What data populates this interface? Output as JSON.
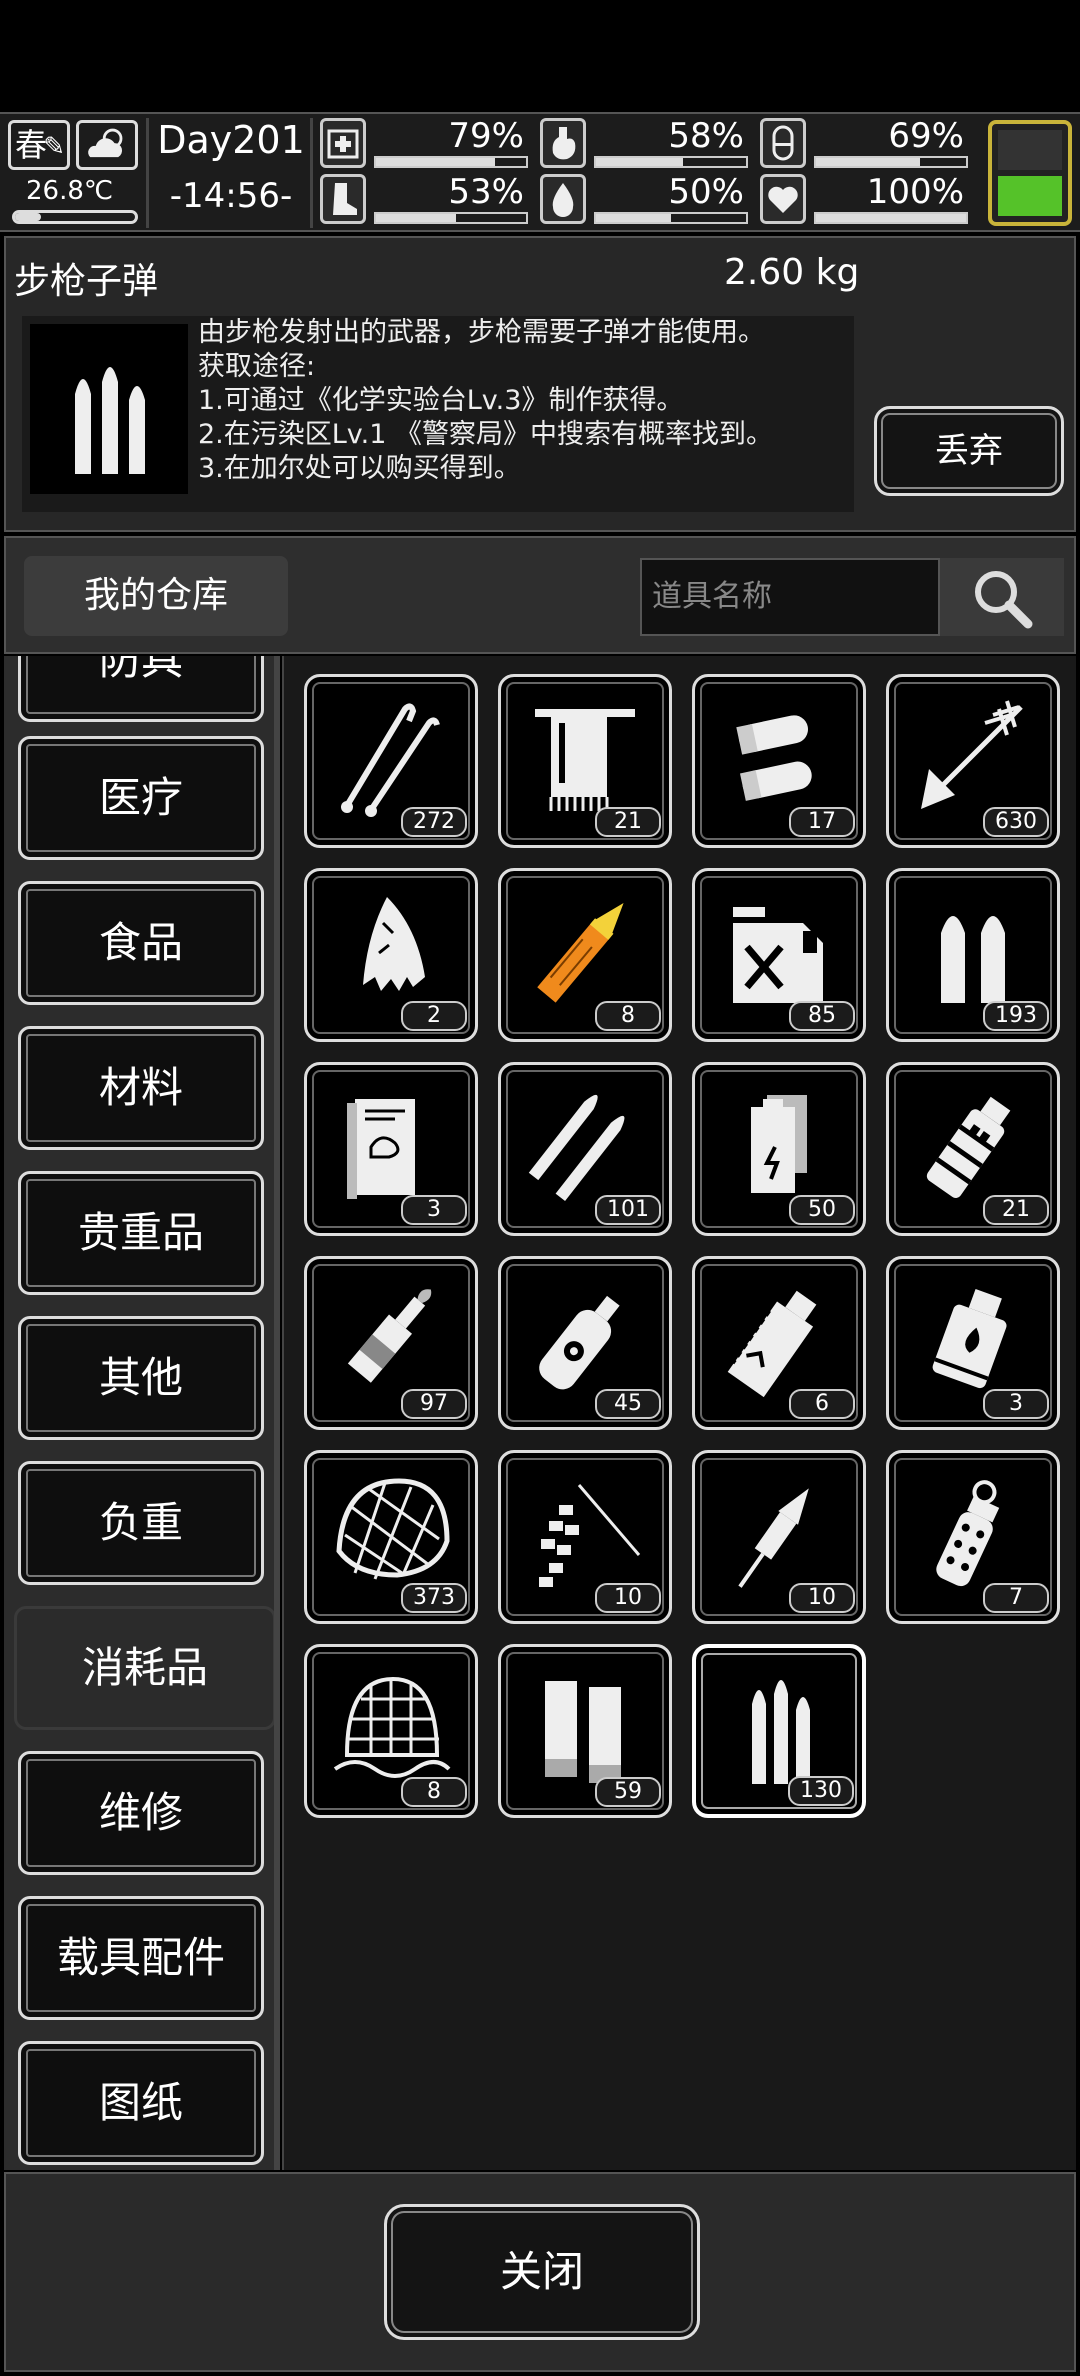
{
  "hud": {
    "season": "春",
    "temperature": "26.8℃",
    "day": "Day201",
    "time": "-14:56-",
    "stats": [
      {
        "icon": "medkit-icon",
        "value": "79%",
        "fill": 0.79
      },
      {
        "icon": "stomach-icon",
        "value": "58%",
        "fill": 0.58
      },
      {
        "icon": "energy-capsule-icon",
        "value": "69%",
        "fill": 0.69
      },
      {
        "icon": "boot-icon",
        "value": "53%",
        "fill": 0.53
      },
      {
        "icon": "water-drop-icon",
        "value": "50%",
        "fill": 0.5
      },
      {
        "icon": "heart-icon",
        "value": "100%",
        "fill": 1.0
      }
    ]
  },
  "detail": {
    "name": "步枪子弹",
    "weight": "2.60 kg",
    "description": "由步枪发射出的武器，步枪需要子弹才能使用。\n获取途径:\n1.可通过《化学实验台Lv.3》制作获得。\n2.在污染区Lv.1 《警察局》中搜索有概率找到。\n3.在加尔处可以购买得到。",
    "discard_label": "丢弃"
  },
  "warehouse": {
    "tab_label": "我的仓库",
    "search_placeholder": "道具名称"
  },
  "categories": [
    {
      "label": "防具",
      "active": false
    },
    {
      "label": "医疗",
      "active": false
    },
    {
      "label": "食品",
      "active": false
    },
    {
      "label": "材料",
      "active": false
    },
    {
      "label": "贵重品",
      "active": false
    },
    {
      "label": "其他",
      "active": false
    },
    {
      "label": "负重",
      "active": false
    },
    {
      "label": "消耗品",
      "active": true
    },
    {
      "label": "维修",
      "active": false
    },
    {
      "label": "载具配件",
      "active": false
    },
    {
      "label": "图纸",
      "active": false
    }
  ],
  "items": [
    {
      "icon": "lockpick-icon",
      "count": "272"
    },
    {
      "icon": "towel-icon",
      "count": "21"
    },
    {
      "icon": "shotgun-shells-icon",
      "count": "17"
    },
    {
      "icon": "arrow-icon",
      "count": "630"
    },
    {
      "icon": "cloth-icon",
      "count": "2"
    },
    {
      "icon": "rocket-ammo-icon",
      "count": "8"
    },
    {
      "icon": "fuel-can-icon",
      "count": "85"
    },
    {
      "icon": "pistol-bullets-icon",
      "count": "193"
    },
    {
      "icon": "book-icon",
      "count": "3"
    },
    {
      "icon": "sniper-bullets-icon",
      "count": "101"
    },
    {
      "icon": "battery-icon",
      "count": "50"
    },
    {
      "icon": "flashbang-icon",
      "count": "21"
    },
    {
      "icon": "molotov-icon",
      "count": "97"
    },
    {
      "icon": "gas-canister-icon",
      "count": "45"
    },
    {
      "icon": "smoke-grenade-icon",
      "count": "6"
    },
    {
      "icon": "incendiary-grenade-icon",
      "count": "3"
    },
    {
      "icon": "net-icon",
      "count": "373"
    },
    {
      "icon": "firecrackers-icon",
      "count": "10"
    },
    {
      "icon": "firework-rocket-icon",
      "count": "10"
    },
    {
      "icon": "stun-grenade-icon",
      "count": "7"
    },
    {
      "icon": "trap-net-icon",
      "count": "8"
    },
    {
      "icon": "shell-casings-icon",
      "count": "59"
    },
    {
      "icon": "rifle-bullets-icon",
      "count": "130",
      "selected": true
    }
  ],
  "close_label": "关闭"
}
